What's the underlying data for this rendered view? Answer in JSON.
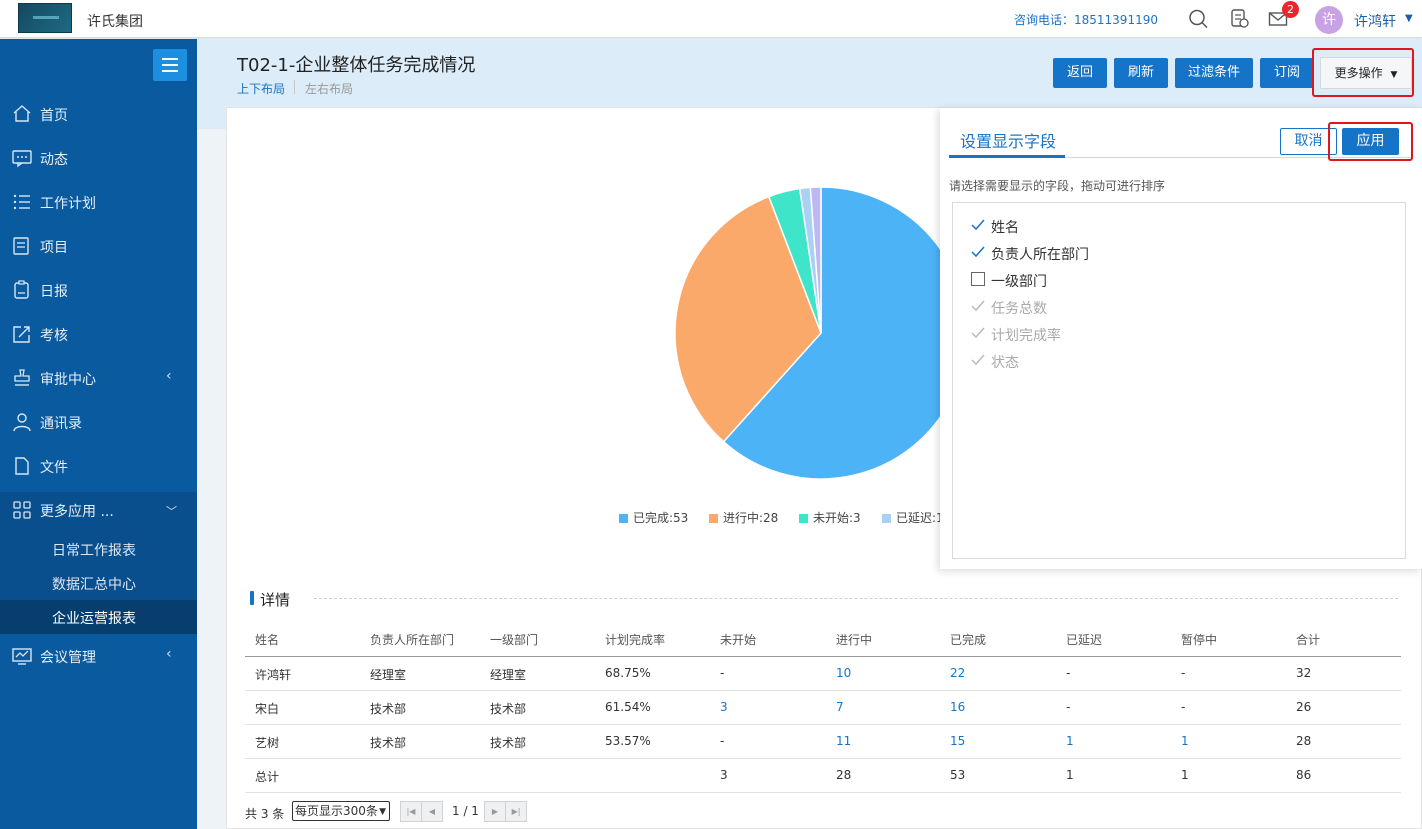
{
  "topbar": {
    "company": "许氏集团",
    "phone": "咨询电话：18511391190",
    "mail_badge": "2",
    "avatar_char": "许",
    "user_name": "许鸿轩"
  },
  "sidebar": {
    "items": [
      {
        "label": "首页",
        "icon": "home-icon"
      },
      {
        "label": "动态",
        "icon": "chat-icon"
      },
      {
        "label": "工作计划",
        "icon": "list-icon"
      },
      {
        "label": "项目",
        "icon": "project-icon"
      },
      {
        "label": "日报",
        "icon": "daily-report-icon"
      },
      {
        "label": "考核",
        "icon": "assessment-icon"
      },
      {
        "label": "审批中心",
        "icon": "approval-icon"
      },
      {
        "label": "通讯录",
        "icon": "contacts-icon"
      },
      {
        "label": "文件",
        "icon": "file-icon"
      },
      {
        "label": "更多应用 ...",
        "icon": "apps-icon"
      },
      {
        "label": "会议管理",
        "icon": "meeting-icon"
      }
    ],
    "sub_items": [
      {
        "label": "日常工作报表"
      },
      {
        "label": "数据汇总中心"
      },
      {
        "label": "企业运营报表"
      }
    ]
  },
  "header": {
    "title": "T02-1-企业整体任务完成情况",
    "layout_top_bottom": "上下布局",
    "layout_left_right": "左右布局",
    "buttons": {
      "back": "返回",
      "refresh": "刷新",
      "filter": "过滤条件",
      "subscribe": "订阅",
      "more": "更多操作",
      "more_caret": "▼"
    }
  },
  "chart_data": {
    "type": "pie",
    "categories": [
      "已完成",
      "进行中",
      "未开始",
      "已延迟",
      "暂停中"
    ],
    "values": [
      53,
      28,
      3,
      1,
      1
    ],
    "colors": [
      "#4db3f7",
      "#fba96b",
      "#3fe5c8",
      "#a9d0f5",
      "#bfb7f2"
    ],
    "legend_visible": [
      "已完成:53",
      "进行中:28",
      "未开始:3",
      "已延迟:1"
    ],
    "legend_position": "bottom"
  },
  "detail": {
    "title": "详情",
    "columns": [
      "姓名",
      "负责人所在部门",
      "一级部门",
      "计划完成率",
      "未开始",
      "进行中",
      "已完成",
      "已延迟",
      "暂停中",
      "合计"
    ],
    "rows": [
      [
        "许鸿轩",
        "经理室",
        "经理室",
        "68.75%",
        "-",
        "10",
        "22",
        "-",
        "-",
        "32"
      ],
      [
        "宋白",
        "技术部",
        "技术部",
        "61.54%",
        "3",
        "7",
        "16",
        "-",
        "-",
        "26"
      ],
      [
        "艺树",
        "技术部",
        "技术部",
        "53.57%",
        "-",
        "11",
        "15",
        "1",
        "1",
        "28"
      ],
      [
        "总计",
        "",
        "",
        "",
        "3",
        "28",
        "53",
        "1",
        "1",
        "86"
      ]
    ],
    "link_columns": [
      4,
      5,
      6,
      7,
      8
    ]
  },
  "pagination": {
    "count": "共 3 条",
    "page_size": "每页显示300条",
    "page": "1 / 1"
  },
  "panel": {
    "title": "设置显示字段",
    "cancel": "取消",
    "apply": "应用",
    "hint": "请选择需要显示的字段，拖动可进行排序",
    "fields": [
      {
        "label": "姓名",
        "state": "checked"
      },
      {
        "label": "负责人所在部门",
        "state": "checked"
      },
      {
        "label": "一级部门",
        "state": "unchecked"
      },
      {
        "label": "任务总数",
        "state": "disabled"
      },
      {
        "label": "计划完成率",
        "state": "disabled"
      },
      {
        "label": "状态",
        "state": "disabled"
      }
    ]
  }
}
